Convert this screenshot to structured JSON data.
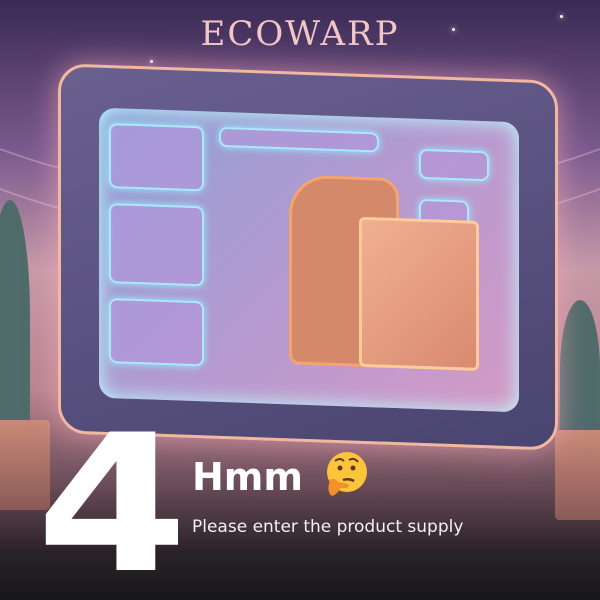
{
  "brand": "ECOWARP",
  "step_number": "4",
  "title": "Hmm",
  "emoji_icon": "thinking-face-icon",
  "subtitle": "Please enter the product supply"
}
